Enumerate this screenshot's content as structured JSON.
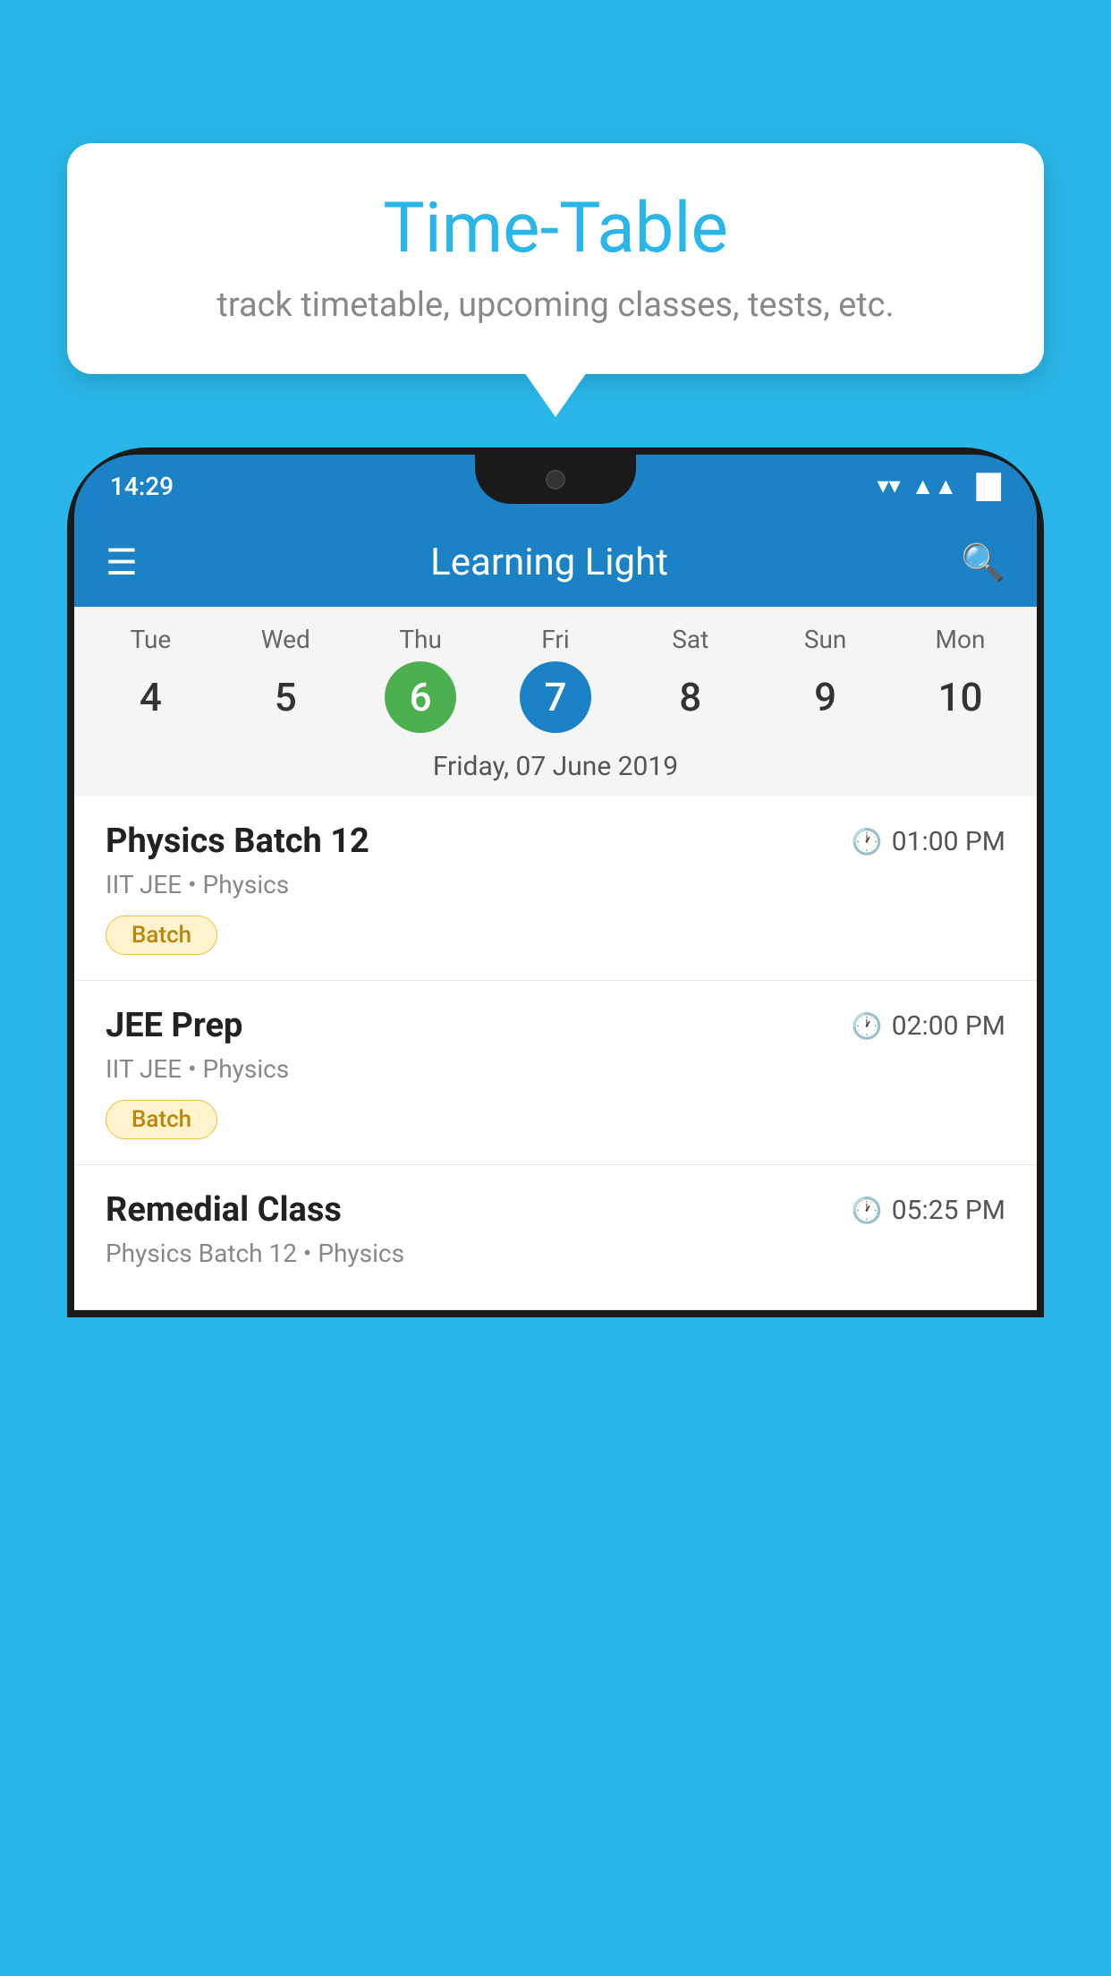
{
  "background_color": "#29b6e8",
  "speech_bubble": {
    "title": "Time-Table",
    "subtitle": "track timetable, upcoming classes, tests, etc."
  },
  "phone": {
    "status_bar": {
      "time": "14:29",
      "wifi": "▼",
      "signal": "◀",
      "battery": "▐"
    },
    "app_bar": {
      "title": "Learning Light",
      "menu_icon": "☰",
      "search_icon": "🔍"
    },
    "calendar": {
      "days": [
        {
          "name": "Tue",
          "number": "4",
          "state": "normal"
        },
        {
          "name": "Wed",
          "number": "5",
          "state": "normal"
        },
        {
          "name": "Thu",
          "number": "6",
          "state": "today"
        },
        {
          "name": "Fri",
          "number": "7",
          "state": "selected"
        },
        {
          "name": "Sat",
          "number": "8",
          "state": "normal"
        },
        {
          "name": "Sun",
          "number": "9",
          "state": "normal"
        },
        {
          "name": "Mon",
          "number": "10",
          "state": "normal"
        }
      ],
      "selected_date": "Friday, 07 June 2019"
    },
    "events": [
      {
        "name": "Physics Batch 12",
        "time": "01:00 PM",
        "meta": "IIT JEE • Physics",
        "tag": "Batch"
      },
      {
        "name": "JEE Prep",
        "time": "02:00 PM",
        "meta": "IIT JEE • Physics",
        "tag": "Batch"
      },
      {
        "name": "Remedial Class",
        "time": "05:25 PM",
        "meta": "Physics Batch 12 • Physics",
        "tag": ""
      }
    ]
  }
}
